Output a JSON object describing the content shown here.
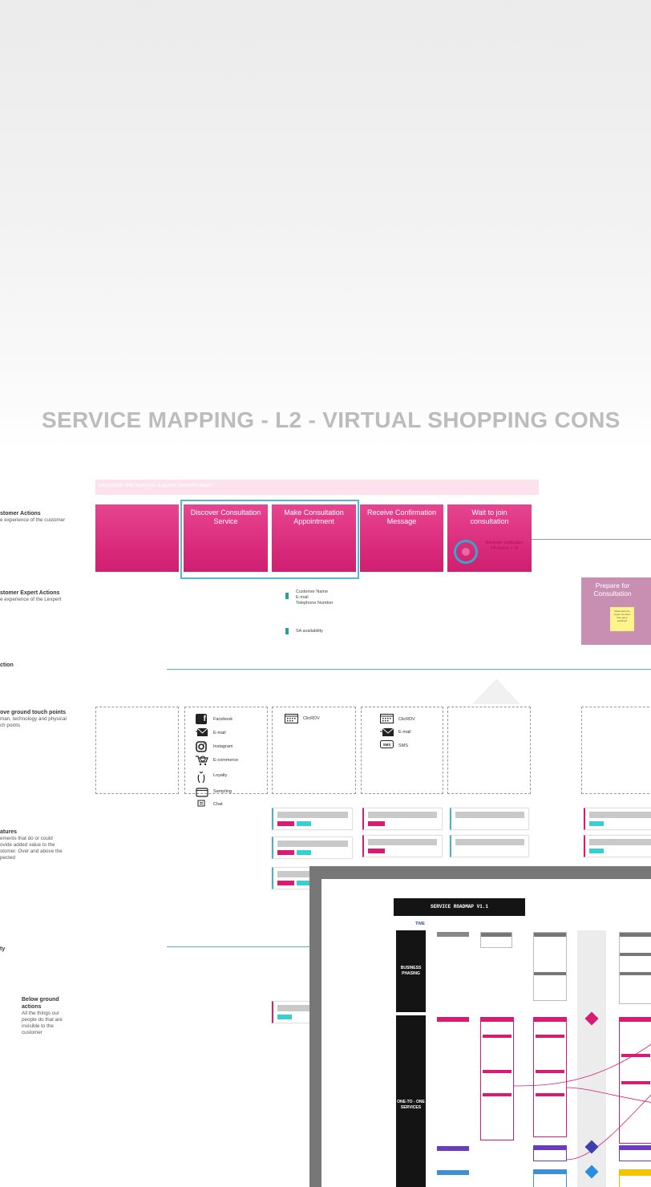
{
  "page": {
    "title": "SERVICE MAPPING - L2 - VIRTUAL SHOPPING CONS"
  },
  "lanes": {
    "customer_actions": {
      "title": "stomer Actions",
      "desc": "e experience of the customer"
    },
    "expert_actions": {
      "title": "stomer Expert Actions",
      "desc": "e experience of the Lexpert"
    },
    "interaction": {
      "title": "ction"
    },
    "touchpoints": {
      "title": "ove ground touch points",
      "desc": "man, technology and physical\nch points"
    },
    "features": {
      "title": "atures",
      "desc": "ements that do or could\novide added value to the\nstomer. Over and above the\npected"
    },
    "visibility": {
      "title": "ty"
    },
    "below_ground": {
      "title": "Below ground\nactions",
      "desc": "All the things our\npeople do that are\ninvisible to the\ncustomer"
    }
  },
  "phase": {
    "label": "DISCOVER THE SERVICE & BOOK APPOINTMENT"
  },
  "customer_cards": [
    {
      "label": ""
    },
    {
      "label": "Discover Consultation Service"
    },
    {
      "label": "Make Consultation Appointment"
    },
    {
      "label": "Receive Confirmation Message"
    },
    {
      "label": "Wait to join consultation"
    }
  ],
  "wait_card_note": "Reminder notification 24h before + 1h",
  "expert_card": {
    "label": "Prepare for Consultation",
    "note": "What does the expert do when they get a booking?"
  },
  "data_notes": {
    "customer_data": [
      "Customer Name",
      "E-mail",
      "Telephone Number"
    ],
    "sa_availability": "SA availability"
  },
  "touchpoints": {
    "col1": [
      {
        "icon": "facebook-icon",
        "label": "Facebook"
      },
      {
        "icon": "email-icon",
        "label": "E-mail"
      },
      {
        "icon": "instagram-icon",
        "label": "Instagram"
      },
      {
        "icon": "ecommerce-icon",
        "label": "E-commerce"
      },
      {
        "icon": "loyalty-icon",
        "label": "Loyalty"
      },
      {
        "icon": "sampling-icon",
        "label": "Sampling"
      },
      {
        "icon": "chat-icon",
        "label": "Chat"
      }
    ],
    "col2": [
      {
        "icon": "calendar-icon",
        "label": "ClicRDV"
      }
    ],
    "col3": [
      {
        "icon": "calendar-icon",
        "label": "ClicRDV"
      },
      {
        "icon": "email-icon",
        "label": "E-mail"
      },
      {
        "icon": "sms-icon",
        "label": "SMS"
      }
    ]
  },
  "roadmap": {
    "title": "SERVICE ROADMAP V1.1",
    "time_label": "TIME",
    "rows": [
      {
        "label": "BUSINESS PHASING"
      },
      {
        "label": "ONE-TO - ONE SERVICES"
      }
    ]
  },
  "colors": {
    "pink": "#d81b73",
    "cyan": "#38cfd0",
    "selection": "#57b6d4",
    "expert_card": "#c98fb2"
  }
}
